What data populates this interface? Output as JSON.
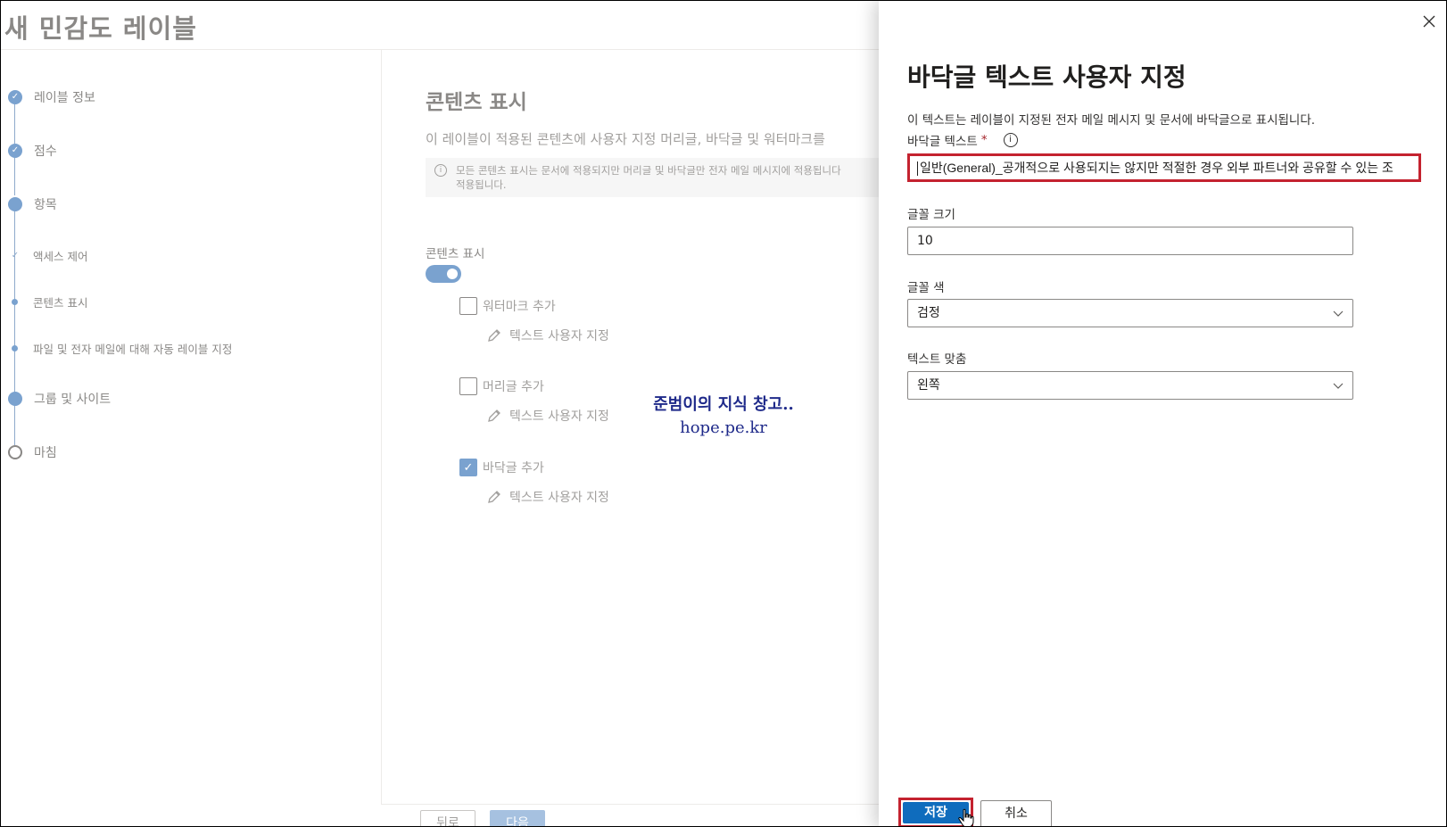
{
  "wizard": {
    "title": "새 민감도 레이블",
    "steps": [
      {
        "label": "레이블 정보",
        "state": "done"
      },
      {
        "label": "점수",
        "state": "done"
      },
      {
        "label": "항목",
        "state": "current"
      },
      {
        "label": "액세스 제어",
        "state": "sub-done"
      },
      {
        "label": "콘텐츠 표시",
        "state": "sub-current"
      },
      {
        "label": "파일 및 전자 메일에 대해 자동 레이블 지정",
        "state": "sub-todo"
      },
      {
        "label": "그룹 및 사이트",
        "state": "todo"
      },
      {
        "label": "마침",
        "state": "todo"
      }
    ],
    "content": {
      "heading": "콘텐츠 표시",
      "description": "이 레이블이 적용된 콘텐츠에 사용자 지정 머리글, 바닥글 및 워터마크를",
      "info_line1": "모든 콘텐츠 표시는 문서에 적용되지만 머리글 및 바닥글만 전자 메일 메시지에 적용됩니다",
      "info_line2": "적용됩니다.",
      "marking_label": "콘텐츠 표시",
      "toggle_on": true,
      "options": [
        {
          "label": "워터마크 추가",
          "checked": false,
          "edit_label": "텍스트 사용자 지정"
        },
        {
          "label": "머리글 추가",
          "checked": false,
          "edit_label": "텍스트 사용자 지정"
        },
        {
          "label": "바닥글 추가",
          "checked": true,
          "edit_label": "텍스트 사용자 지정"
        }
      ]
    },
    "watermark_line1": "준범이의 지식 창고..",
    "watermark_line2": "hope.pe.kr",
    "back_label": "뒤로",
    "next_label": "다음"
  },
  "panel": {
    "title": "바닥글 텍스트 사용자 지정",
    "description": "이 텍스트는 레이블이 지정된 전자 메일 메시지 및 문서에 바닥글으로 표시됩니다.",
    "footer_text_label": "바닥글 텍스트",
    "required_mark": "*",
    "footer_text_value": "일반(General)_공개적으로 사용되지는 않지만 적절한 경우 외부 파트너와 공유할 수 있는 조",
    "font_size_label": "글꼴 크기",
    "font_size_value": "10",
    "font_color_label": "글꼴 색",
    "font_color_value": "검정",
    "align_label": "텍스트 맞춤",
    "align_value": "왼쪽",
    "save_label": "저장",
    "cancel_label": "취소"
  },
  "colors": {
    "accent": "#0f6cbd",
    "highlight_border": "#c4222f",
    "dimmed_step": "#7aa2cf"
  }
}
